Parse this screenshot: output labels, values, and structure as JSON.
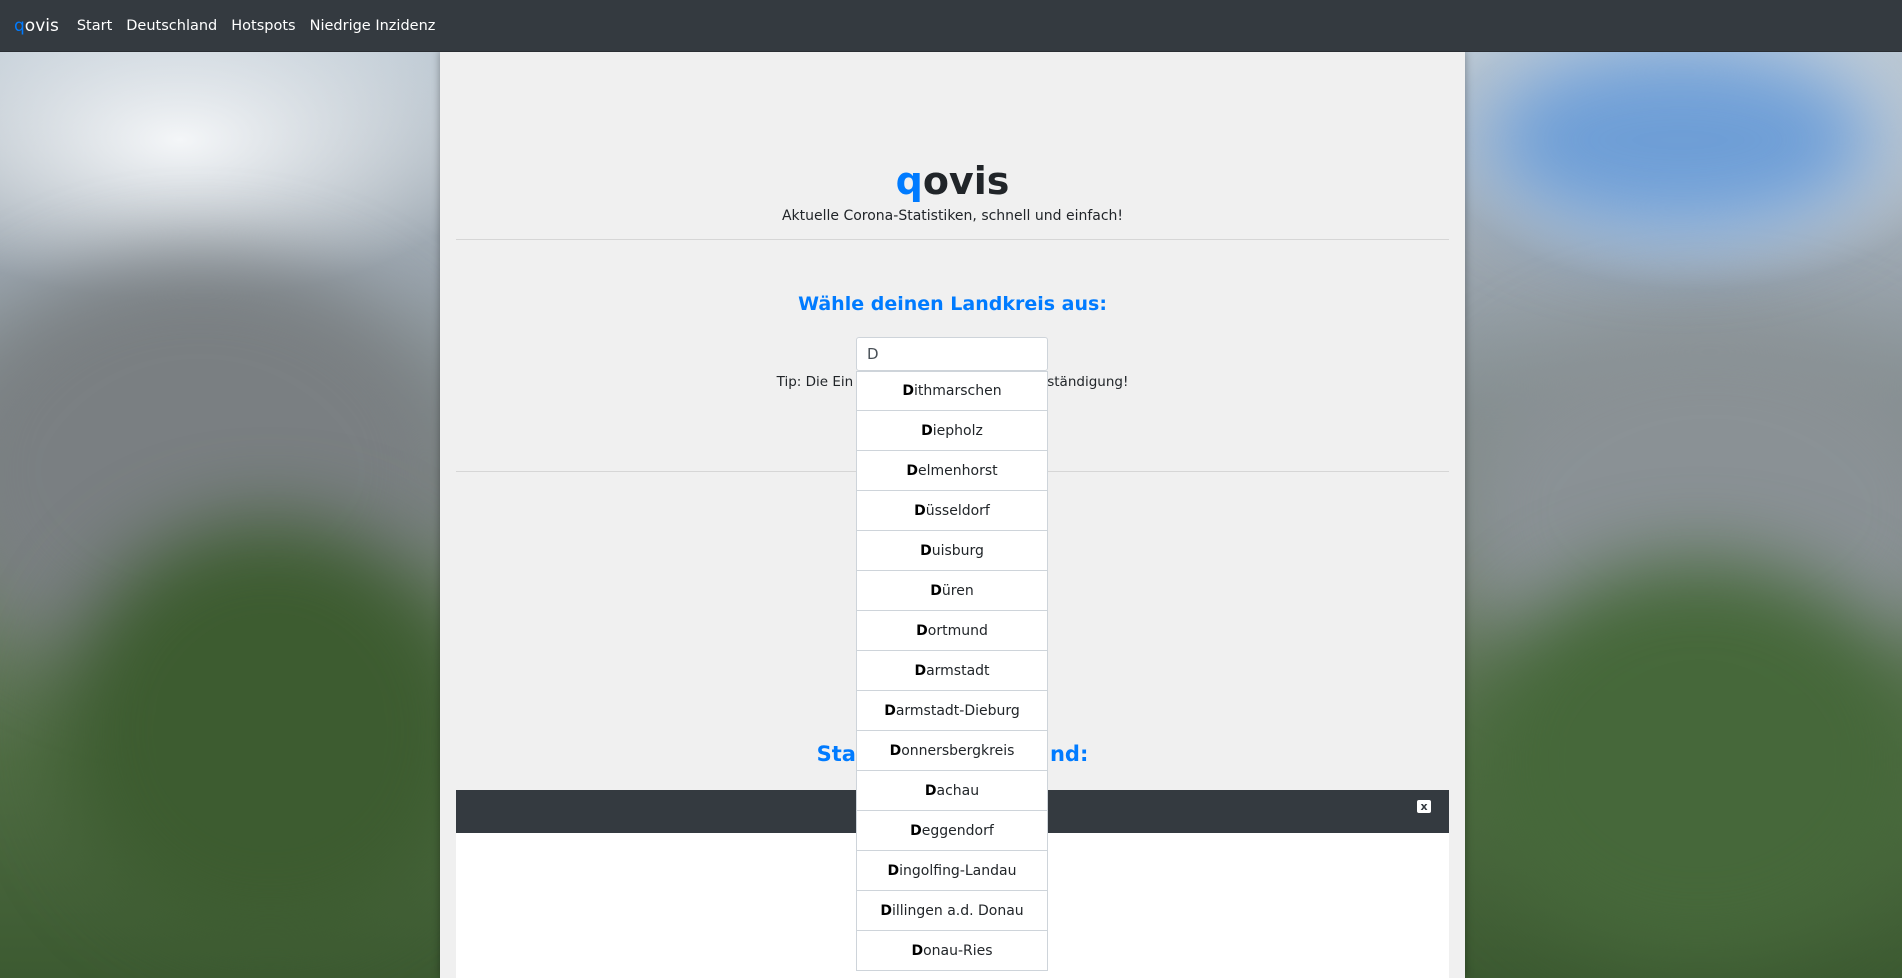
{
  "navbar": {
    "brand_q": "q",
    "brand_rest": "ovis",
    "items": [
      "Start",
      "Deutschland",
      "Hotspots",
      "Niedrige Inzidenz"
    ]
  },
  "hero": {
    "logo_q": "q",
    "logo_rest": "ovis",
    "tagline": "Aktuelle Corona-Statistiken, schnell und einfach!"
  },
  "selector": {
    "title": "Wähle deinen Landkreis aus:",
    "input_value": "D",
    "tip_left": "Tip: Die Ein",
    "tip_right": "ständigung!"
  },
  "autocomplete": {
    "match": "D",
    "items": [
      "ithmarschen",
      "iepholz",
      "elmenhorst",
      "üsseldorf",
      "uisburg",
      "üren",
      "ortmund",
      "armstadt",
      "armstadt-Dieburg",
      "onnersbergkreis",
      "achau",
      "eggendorf",
      "ingolfing-Landau",
      "illingen a.d. Donau",
      "onau-Ries"
    ]
  },
  "stats": {
    "title_left": "Sta",
    "title_right": "nd:",
    "close_icon": "x"
  },
  "colors": {
    "accent": "#007bff",
    "navbar": "#343a40",
    "card": "#f0f0f0"
  }
}
